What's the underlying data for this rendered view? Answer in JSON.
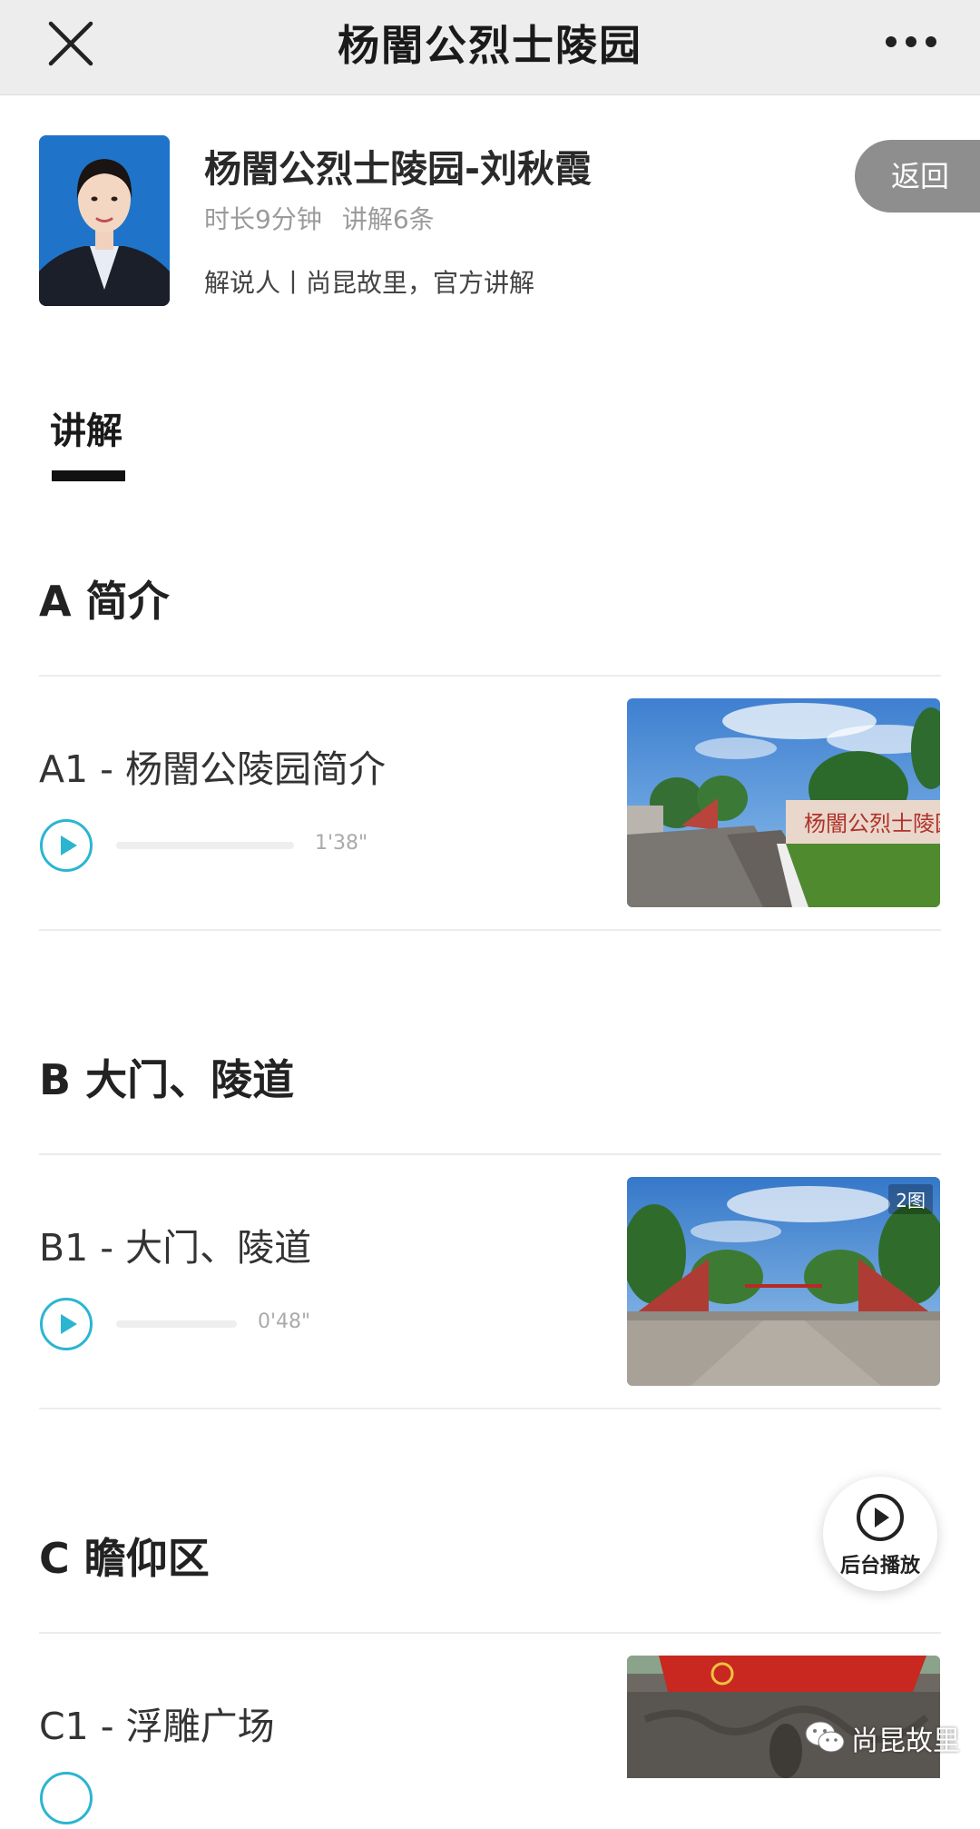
{
  "header": {
    "title": "杨闇公烈士陵园",
    "close_icon": "close-icon",
    "more_icon": "more-dots-icon"
  },
  "guide": {
    "name": "杨闇公烈士陵园-刘秋霞",
    "duration": "时长9分钟",
    "count": "讲解6条",
    "description": "解说人丨尚昆故里，官方讲解",
    "back_label": "返回"
  },
  "tabs": [
    {
      "label": "讲解",
      "active": true
    }
  ],
  "sections": [
    {
      "heading": "A 简介",
      "items": [
        {
          "title": "A1 - 杨闇公陵园简介",
          "duration": "1'38\"",
          "progress": 0,
          "image_count": ""
        }
      ]
    },
    {
      "heading": "B 大门、陵道",
      "items": [
        {
          "title": "B1 - 大门、陵道",
          "duration": "0'48\"",
          "progress": 0,
          "image_count": "2图"
        }
      ]
    },
    {
      "heading": "C 瞻仰区",
      "items": [
        {
          "title": "C1 - 浮雕广场",
          "duration": "",
          "progress": 0,
          "image_count": ""
        }
      ]
    }
  ],
  "floating": {
    "label": "后台播放",
    "icon": "play-circle-icon"
  },
  "watermark": {
    "text": "尚昆故里",
    "icon": "wechat-icon"
  },
  "colors": {
    "accent": "#2bb5d1",
    "topbar_bg": "#ededed",
    "back_button": "#8e8e8e"
  }
}
